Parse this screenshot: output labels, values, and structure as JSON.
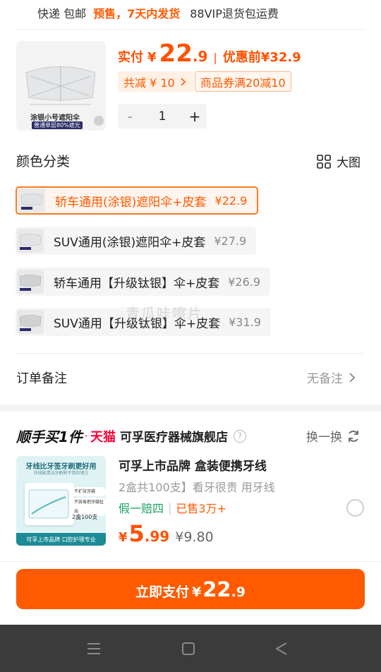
{
  "shipping": {
    "express": "快递 包邮",
    "presale": "预售，7天内发货",
    "vip": "88VIP退货包运费"
  },
  "product": {
    "thumb_caption": "涂银小号遮阳伞",
    "thumb_sub": "普通单层80%遮光",
    "actual_label": "实付",
    "currency": "¥",
    "price_int": "22",
    "price_dec": ".9",
    "before_label": "优惠前",
    "before_price": "¥32.9",
    "reduce_tag": "共减 ¥ 10",
    "coupon_tag": "商品券满20减10",
    "quantity": "1",
    "minus": "-",
    "plus": "+"
  },
  "color_section": {
    "title": "颜色分类",
    "big_pic": "大图",
    "options": [
      {
        "label": "轿车通用(涂银)遮阳伞+皮套",
        "price": "¥22.9",
        "selected": true
      },
      {
        "label": "SUV通用(涂银)遮阳伞+皮套",
        "price": "¥27.9",
        "selected": false
      },
      {
        "label": "轿车通用【升级钛银】伞+皮套",
        "price": "¥26.9",
        "selected": false
      },
      {
        "label": "SUV通用【升级钛银】伞+皮套",
        "price": "¥31.9",
        "selected": false
      }
    ],
    "watermark": "青瓜咔嚓片"
  },
  "order_note": {
    "label": "订单备注",
    "value": "无备注"
  },
  "recommend": {
    "title": "顺手买1件",
    "tmall": "天猫",
    "shop": "可孚医疗器械旗舰店",
    "help": "?",
    "swap": "换一换",
    "thumb_line1": "牙线比牙签牙刷更好用",
    "thumb_line2": "牙线能清洁牙刷刷不到的地方",
    "thumb_bullets": [
      "不扩张牙缝",
      "不容易把牙龈扯出"
    ],
    "thumb_count": "2盒100支",
    "thumb_foot": "可孚上市品牌 口腔护理专业",
    "name": "可孚上市品牌 盒装便携牙线",
    "desc": "2盒共100支】看牙很贵 用牙线",
    "guarantee": "假一赔四",
    "sold": "已售3万+",
    "currency": "¥",
    "price_int": "5",
    "price_dec": ".99",
    "orig_price": "¥9.80"
  },
  "pay": {
    "label": "立即支付",
    "currency": "¥",
    "price_int": "22",
    "price_dec": ".9"
  },
  "navbar": {
    "icons": [
      "menu-icon",
      "home-square-icon",
      "back-triangle-icon"
    ]
  },
  "colors": {
    "accent": "#ff5a00",
    "tmall_red": "#ff0036",
    "green": "#1aa260",
    "nav_bg": "#3b3b3b"
  }
}
